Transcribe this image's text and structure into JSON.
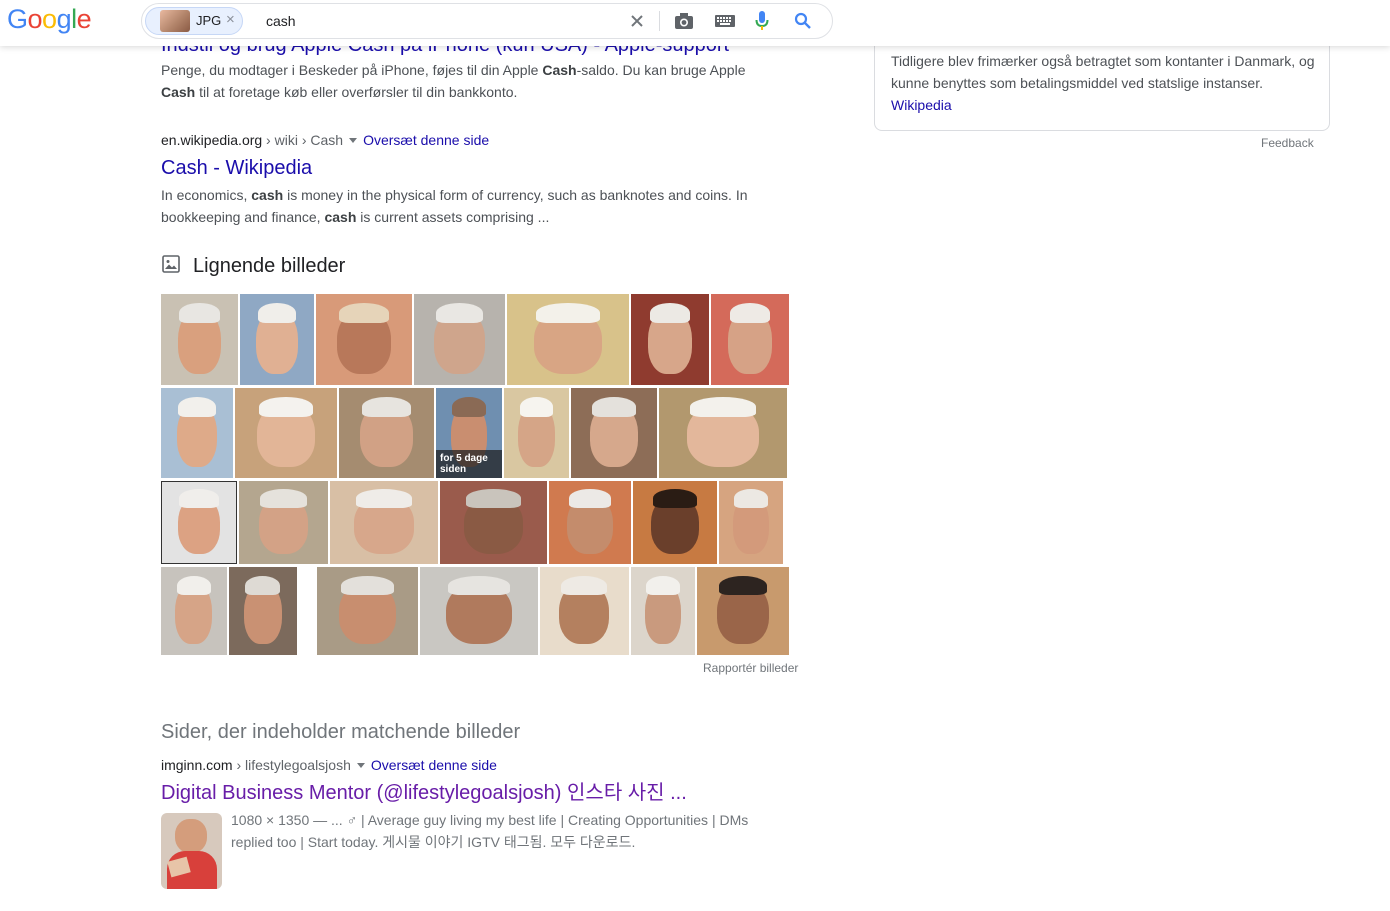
{
  "header": {
    "logo_letters": [
      "G",
      "o",
      "o",
      "g",
      "l",
      "e"
    ],
    "chip_label": "JPG",
    "chip_close": "×",
    "query": "cash"
  },
  "results": [
    {
      "title": "Indstil og brug Apple Cash på iPhone (kun USA) - Apple-support",
      "snippet_parts": [
        "Penge, du modtager i Beskeder på iPhone, føjes til din Apple ",
        "Cash",
        "-saldo. Du kan bruge Apple ",
        "Cash",
        " til at foretage køb eller overførsler til din bankkonto."
      ]
    },
    {
      "domain": "en.wikipedia.org",
      "path": " › wiki › Cash",
      "translate": "Oversæt denne side",
      "title": "Cash - Wikipedia",
      "snippet_parts": [
        "In economics, ",
        "cash",
        " is money in the physical form of currency, such as banknotes and coins. In bookkeeping and finance, ",
        "cash",
        " is current assets comprising ..."
      ]
    }
  ],
  "similar": {
    "heading": "Lignende billeder",
    "badge_text": "for 5 dage siden",
    "report": "Rapportér billeder"
  },
  "pages": {
    "heading": "Sider, der indeholder matchende billeder",
    "domain": "imginn.com",
    "path": " › lifestylegoalsjosh",
    "translate": "Oversæt denne side",
    "title": "Digital Business Mentor  (@lifestylegoalsjosh) 인스타 사진 ...",
    "line1": "1080 × 1350 — ... ♂ | Average guy living my best life | Creating Opportunities | DMs",
    "line2": "replied too | Start today. 게시물 이야기 IGTV 태그됨. 모두 다운로드."
  },
  "knowledge_panel": {
    "text": "Tidligere blev frimærker også betragtet som kontanter i Danmark, og kunne benyttes som betalingsmiddel ved statslige instanser.",
    "source": "Wikipedia",
    "feedback": "Feedback"
  },
  "colors": {
    "link": "#1a0dab",
    "visited": "#681da8",
    "snippet": "#4d5156"
  },
  "icons": [
    "clear-icon",
    "camera-icon",
    "keyboard-icon",
    "mic-icon",
    "search-icon",
    "image-icon"
  ]
}
